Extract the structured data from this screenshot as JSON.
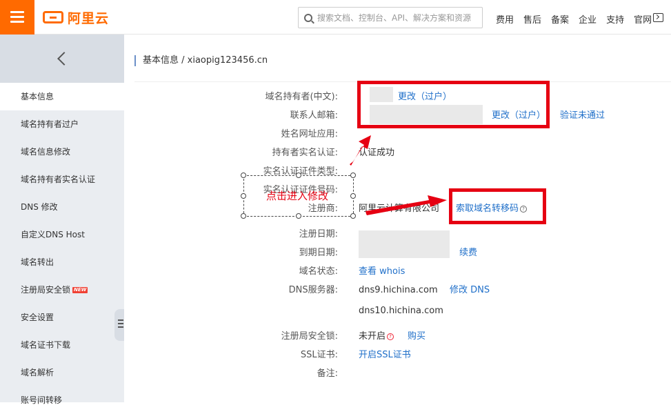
{
  "header": {
    "logo_text": "阿里云",
    "search_placeholder": "搜索文档、控制台、API、解决方案和资源",
    "nav": [
      "费用",
      "售后",
      "备案",
      "企业",
      "支持",
      "官网"
    ],
    "accent_color": "#ff6a00"
  },
  "sidebar": {
    "items": [
      {
        "label": "基本信息",
        "active": true
      },
      {
        "label": "域名持有者过户"
      },
      {
        "label": "域名信息修改"
      },
      {
        "label": "域名持有者实名认证"
      },
      {
        "label": "DNS 修改"
      },
      {
        "label": "自定义DNS Host"
      },
      {
        "label": "域名转出"
      },
      {
        "label": "注册局安全锁",
        "badge": "NEW"
      },
      {
        "label": "安全设置"
      },
      {
        "label": "域名证书下载"
      },
      {
        "label": "域名解析"
      },
      {
        "label": "账号间转移"
      }
    ]
  },
  "breadcrumb": "基本信息 / xiaopig123456.cn",
  "info": {
    "owner_cn": {
      "label": "域名持有者(中文):",
      "link": "更改（过户）"
    },
    "email": {
      "label": "联系人邮箱:",
      "link1": "更改（过户）",
      "link2": "验证未通过"
    },
    "website": {
      "label": "姓名网址应用:"
    },
    "realname": {
      "label": "持有者实名认证:",
      "value": "认证成功"
    },
    "cert_type": {
      "label": "实名认证证件类型:"
    },
    "cert_no": {
      "label": "实名认证证件号码:"
    },
    "registrar": {
      "label": "注册商:",
      "value": "阿里云计算有限公司",
      "link": "索取域名转移码"
    },
    "reg_date": {
      "label": "注册日期:"
    },
    "exp_date": {
      "label": "到期日期:",
      "link": "续费"
    },
    "status": {
      "label": "域名状态:",
      "link": "查看 whois"
    },
    "dns": {
      "label": "DNS服务器:",
      "value1": "dns9.hichina.com",
      "link": "修改 DNS",
      "value2": "dns10.hichina.com"
    },
    "lock": {
      "label": "注册局安全锁:",
      "value": "未开启",
      "link": "购买"
    },
    "ssl": {
      "label": "SSL证书:",
      "link": "开启SSL证书"
    },
    "note": {
      "label": "备注:"
    }
  },
  "annotation": {
    "text": "点击进入修改",
    "color": "#e60012"
  }
}
